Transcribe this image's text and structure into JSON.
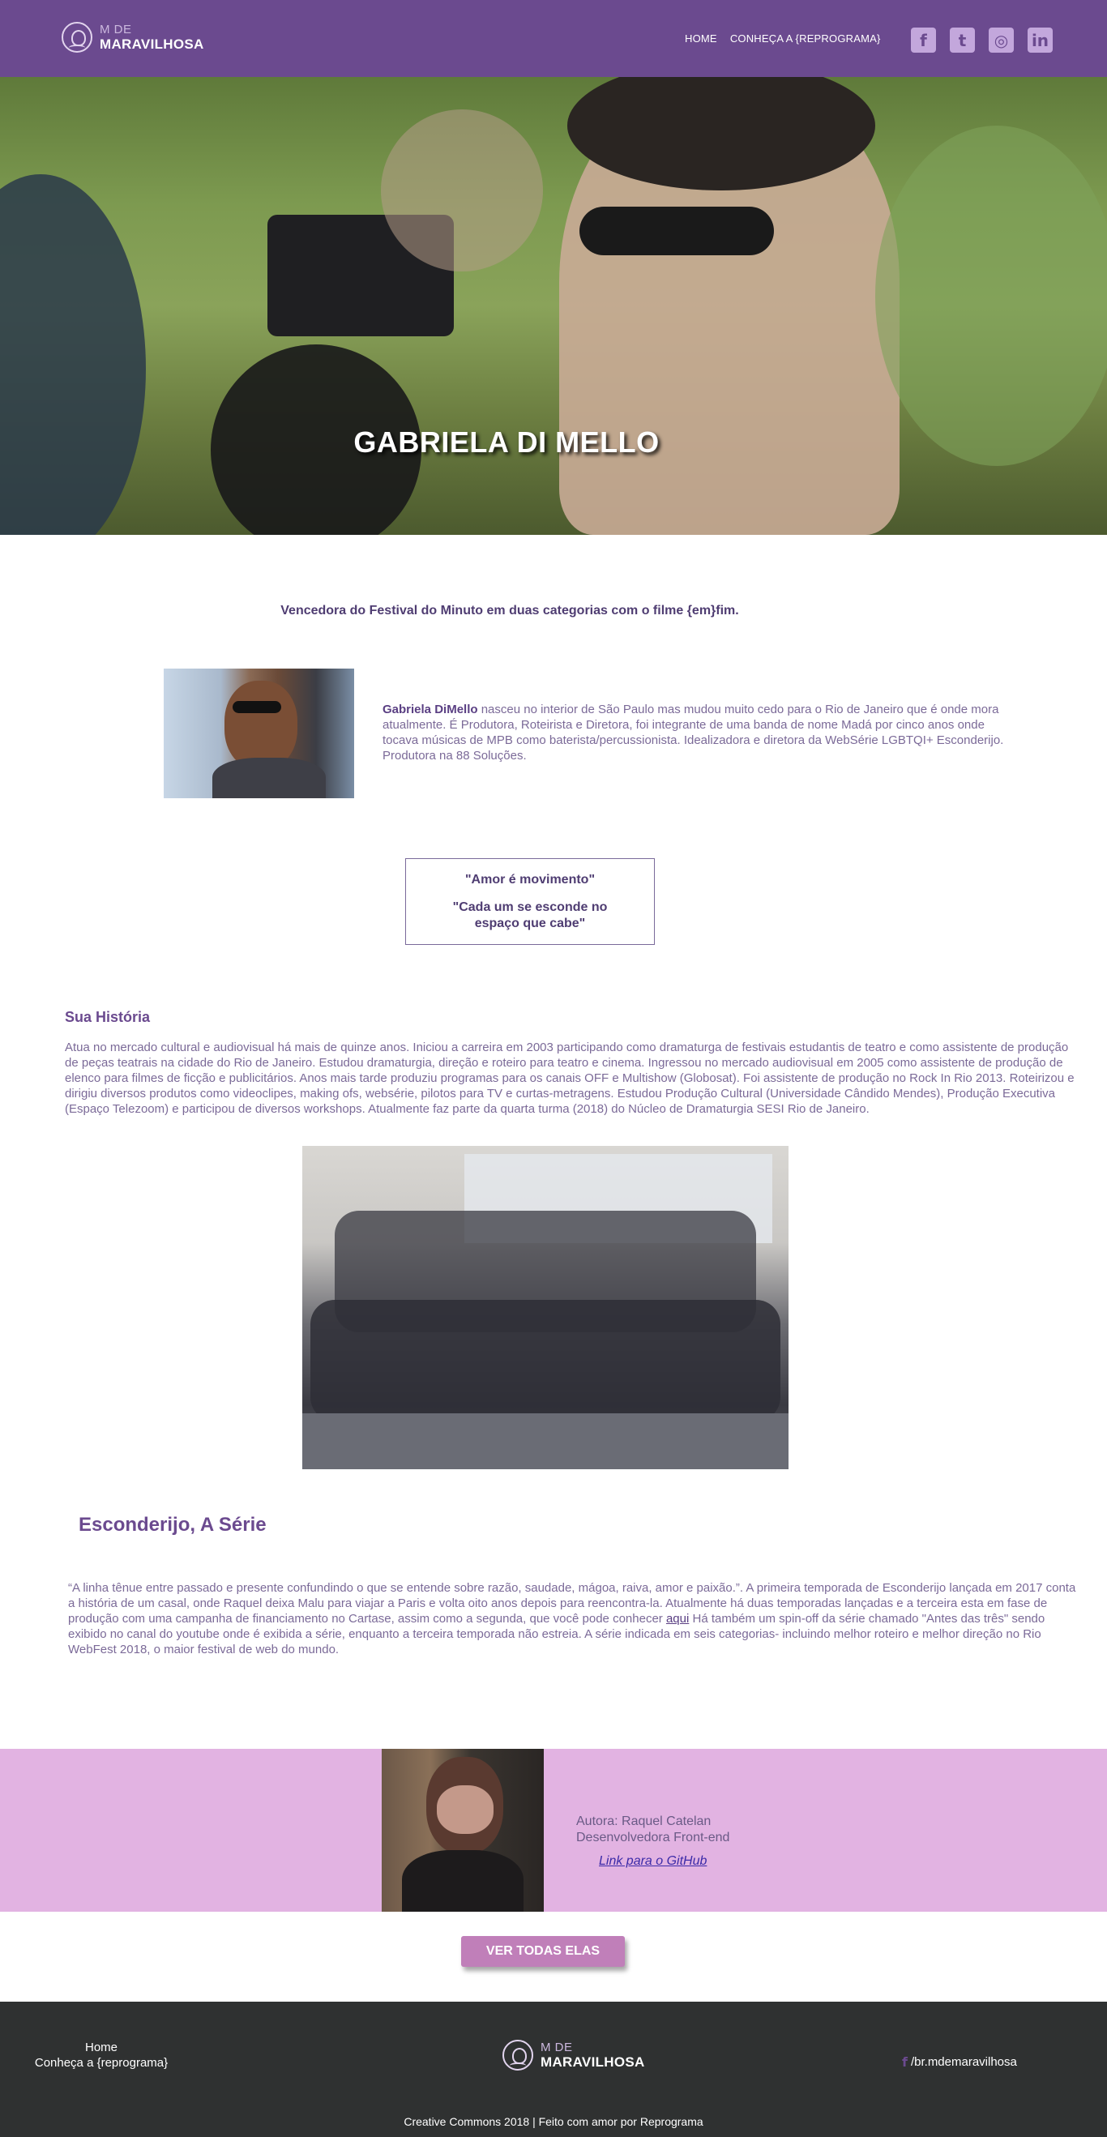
{
  "header": {
    "logo_top": "M DE",
    "logo_bottom": "MARAVILHOSA",
    "nav": [
      "HOME",
      "CONHEÇA A {REPROGRAMA}"
    ],
    "socials": [
      "facebook-icon",
      "twitter-icon",
      "instagram-icon",
      "linkedin-icon"
    ]
  },
  "hero": {
    "title": "GABRIELA DI MELLO"
  },
  "main": {
    "subtitle": "Vencedora do Festival do Minuto em duas categorias com o filme {em}fim.",
    "bio_name": "Gabriela DiMello",
    "bio_text": " nasceu no interior de São Paulo mas mudou muito cedo para o Rio de Janeiro que é onde mora atualmente. É Produtora, Roteirista e Diretora, foi integrante de uma banda de nome Madá por cinco anos onde tocava músicas de MPB como baterista/percussionista. Idealizadora e diretora da WebSérie LGBTQI+ Esconderijo. Produtora na 88 Soluções.",
    "quote_1": "\"Amor é movimento\"",
    "quote_2": "\"Cada um se esconde no espaço que cabe\"",
    "historia_title": "Sua História",
    "historia_text": "Atua no mercado cultural e audiovisual há mais de quinze anos. Iniciou a carreira em 2003 participando como dramaturga de festivais estudantis de teatro e como assistente de produção de peças teatrais na cidade do Rio de Janeiro. Estudou dramaturgia, direção e roteiro para teatro e cinema. Ingressou no mercado audiovisual em 2005 como assistente de produção de elenco para filmes de ficção e publicitários. Anos mais tarde produziu programas para os canais OFF e Multishow (Globosat). Foi assistente de produção no Rock In Rio 2013. Roteirizou e dirigiu diversos produtos como videoclipes, making ofs, websérie, pilotos para TV e curtas-metragens. Estudou Produção Cultural (Universidade Cândido Mendes), Produção Executiva (Espaço Telezoom) e participou de diversos workshops. Atualmente faz parte da quarta turma (2018) do Núcleo de Dramaturgia SESI Rio de Janeiro.",
    "serie_title": "Esconderijo, A Série",
    "serie_text_1": "“A linha tênue entre passado e presente confundindo o que se entende sobre razão, saudade, mágoa, raiva, amor e paixão.”. A primeira temporada de Esconderijo lançada em 2017 conta a história de um casal, onde Raquel deixa Malu para viajar a Paris e volta oito anos depois para reencontra-la. Atualmente há duas temporadas lançadas e a terceira esta em fase de produção com uma campanha de financiamento no Cartase, assim como a segunda, que você pode conhecer ",
    "serie_link": "aqui",
    "serie_text_2": " Há também um spin-off da série chamado \"Antes das três\" sendo exibido no canal do youtube onde é exibida a série, enquanto a terceira temporada não estreia. A série indicada em seis categorias- incluindo melhor roteiro e melhor direção no Rio WebFest 2018, o maior festival de web do mundo."
  },
  "author": {
    "name": "Autora: Raquel Catelan",
    "role": "Desenvolvedora Front-end",
    "link": "Link para o GitHub"
  },
  "cta": {
    "label": "VER TODAS ELAS"
  },
  "footer": {
    "links": [
      "Home",
      "Conheça a {reprograma}"
    ],
    "logo_top": "M DE",
    "logo_bottom": "MARAVILHOSA",
    "social_text": "/br.mdemaravilhosa",
    "copyright": "Creative Commons 2018 | Feito com amor por Reprograma"
  },
  "colors": {
    "header_bg": "#6b4a8f",
    "accent": "#c07fb9",
    "author_band": "#e2b3e2",
    "footer_bg": "#2f3131",
    "text_purple": "#7b6a98"
  }
}
